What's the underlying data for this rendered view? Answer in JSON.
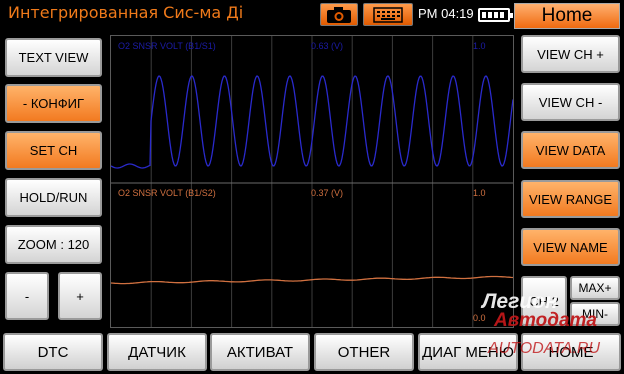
{
  "header": {
    "title": "Интегрированная Сис-ма Ді",
    "time": "PM 04:19",
    "home_label": "Home",
    "camera_icon": "camera-icon",
    "keyboard_icon": "keyboard-icon",
    "battery_icon": "battery-icon"
  },
  "left_buttons": {
    "text_view": "TEXT VIEW",
    "config": "- КОНФИГ",
    "set_ch": "SET CH",
    "hold_run": "HOLD/RUN",
    "zoom": "ZOOM : 120",
    "minus": "-",
    "plus": "+"
  },
  "right_buttons": {
    "view_ch_plus": "VIEW CH +",
    "view_ch_minus": "VIEW CH -",
    "view_data": "VIEW DATA",
    "view_range": "VIEW RANGE",
    "view_name": "VIEW NAME",
    "ch2": "CH 2",
    "max_plus": "MAX+",
    "max_minus": "MIN-"
  },
  "graph": {
    "ch1": {
      "name": "O2 SNSR VOLT (B1/S1)",
      "value": "0.63 (V)",
      "max": "1.0",
      "color": "#2a2acc"
    },
    "ch2": {
      "name": "O2 SNSR VOLT (B1/S2)",
      "value": "0.37 (V)",
      "max": "1.0",
      "min": "0.0",
      "color": "#d07040"
    }
  },
  "bottom_buttons": {
    "dtc": "DTC",
    "sensor": "ДАТЧИК",
    "activate": "АКТИВАТ",
    "other": "OTHER",
    "diag_menu": "ДИАГ МЕНЮ",
    "home": "HOME"
  },
  "watermark": {
    "line1": "Легион",
    "line2": "Автодата",
    "line3": "AUTODATA.RU"
  },
  "colors": {
    "accent": "#f27a20",
    "title": "#f07a1a",
    "watermark": "#c0181a"
  }
}
